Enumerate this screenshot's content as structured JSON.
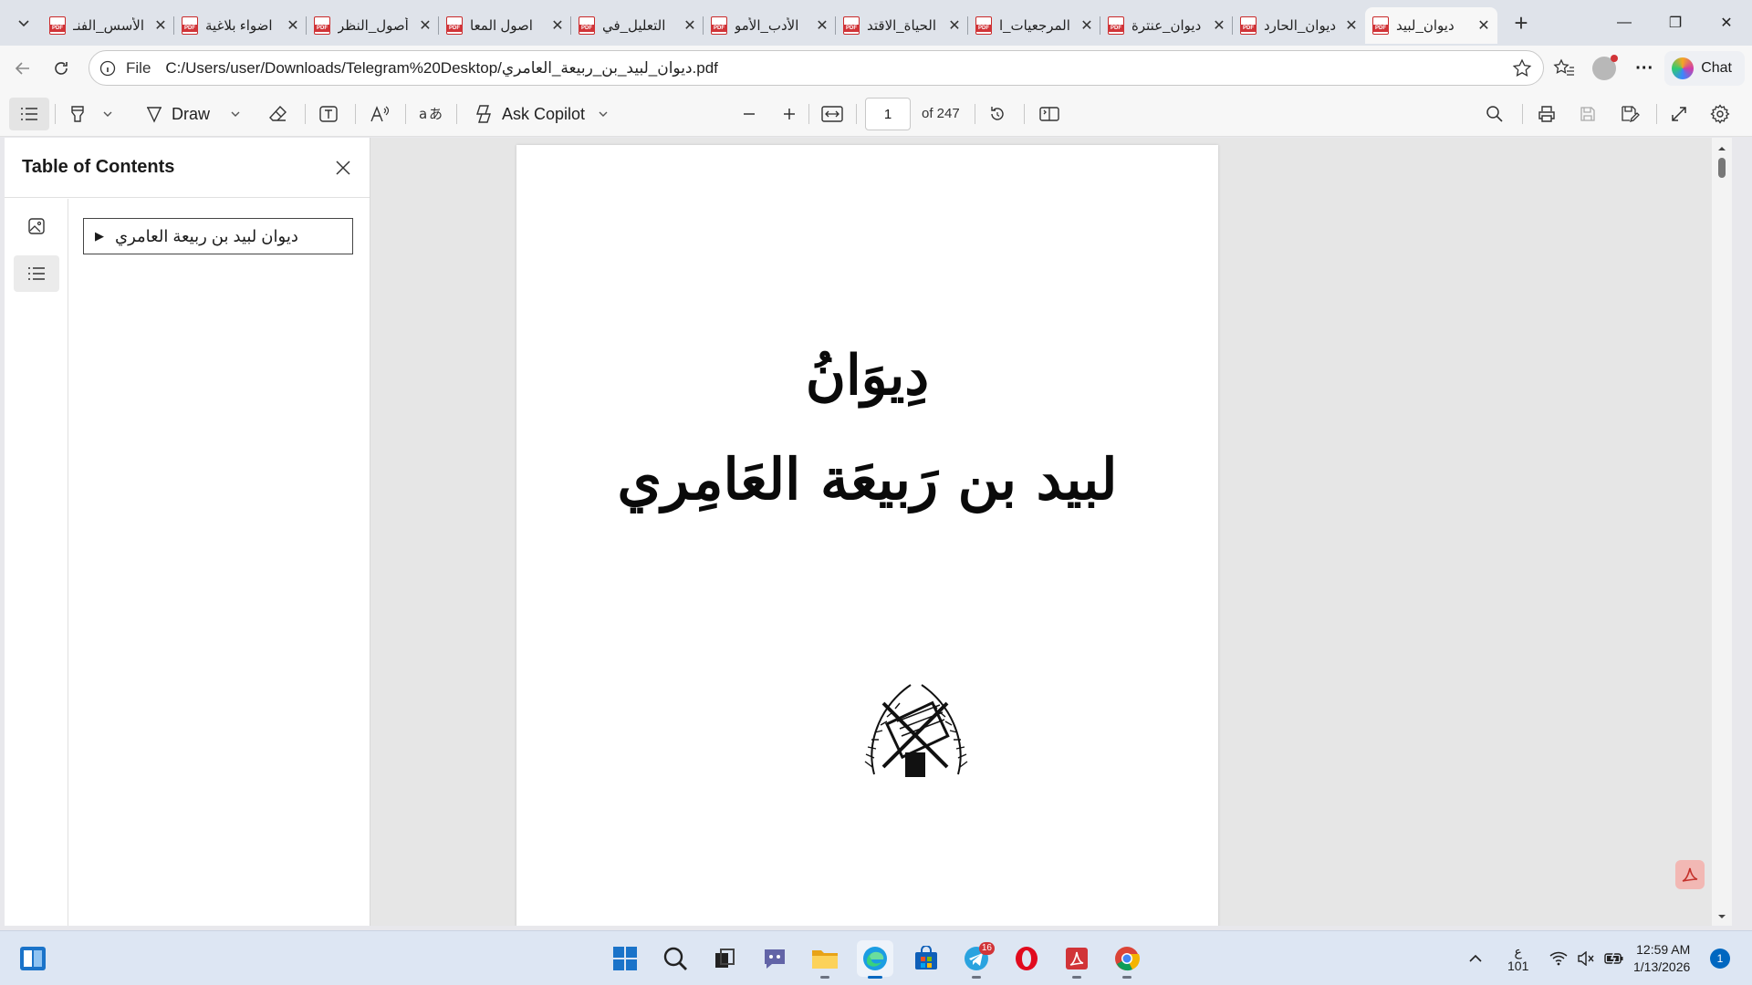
{
  "browser": {
    "tabs": [
      {
        "title": "الأسس_الفنـ",
        "active": false
      },
      {
        "title": "اضواء بلاغية",
        "active": false
      },
      {
        "title": "أصول_النظر",
        "active": false
      },
      {
        "title": "اصول المعا",
        "active": false
      },
      {
        "title": "التعليل_في",
        "active": false
      },
      {
        "title": "الأدب_الأمو",
        "active": false
      },
      {
        "title": "الحياة_الاقتد",
        "active": false
      },
      {
        "title": "المرجعيات_ا",
        "active": false
      },
      {
        "title": "ديوان_عنترة",
        "active": false
      },
      {
        "title": "ديوان_الحارد",
        "active": false
      },
      {
        "title": "ديوان_لبيد",
        "active": true
      }
    ],
    "address": {
      "scheme_label": "File",
      "url": "C:/Users/user/Downloads/Telegram%20Desktop/ديوان_لبيد_بن_ربيعة_العامري.pdf"
    },
    "chat_label": "Chat"
  },
  "pdf_toolbar": {
    "draw_label": "Draw",
    "copilot_label": "Ask Copilot",
    "page_current": "1",
    "page_total_label": "of 247"
  },
  "sidebar": {
    "title": "Table of Contents",
    "toc_items": [
      {
        "label": "ديوان لبيد بن ربيعة العامري"
      }
    ]
  },
  "document": {
    "heading": "دِيوَانُ",
    "subheading": "لبيد بن رَبيعَة العَامِري"
  },
  "taskbar": {
    "telegram_badge": "16",
    "lang_top": "ع",
    "lang_bottom": "101",
    "time": "12:59 AM",
    "date": "1/13/2026",
    "notification_count": "1"
  },
  "colors": {
    "accent": "#0067c0",
    "pdf_red": "#d13438",
    "tabstrip_bg": "#dfe3ea",
    "taskbar_bg": "#dde6f3"
  }
}
